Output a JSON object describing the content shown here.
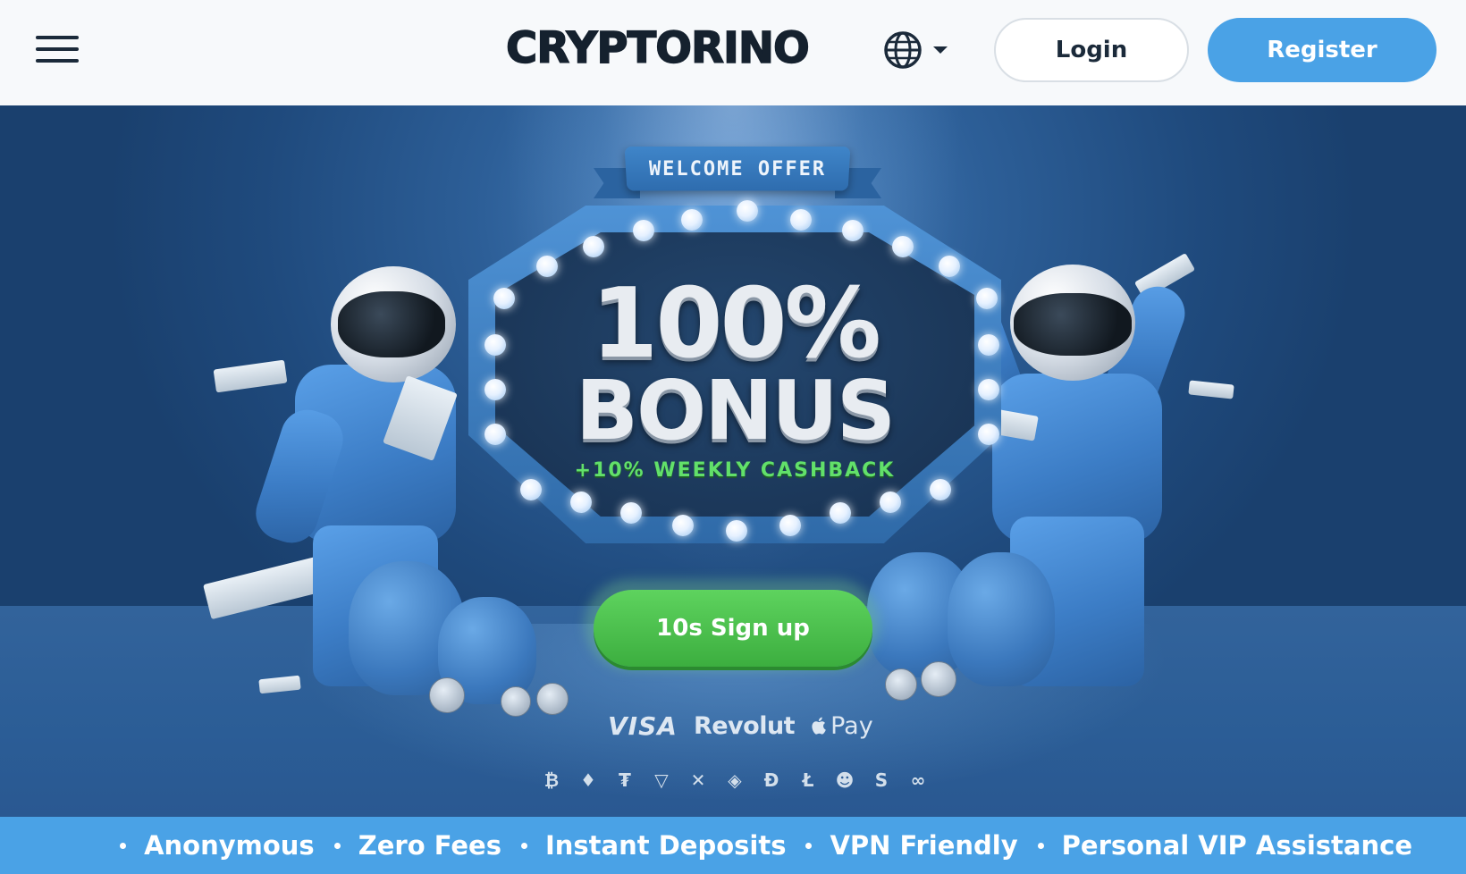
{
  "header": {
    "menu_icon": "hamburger-menu-icon",
    "logo": "CRYPTORINO",
    "language_icon": "globe-icon",
    "login_label": "Login",
    "register_label": "Register"
  },
  "hero": {
    "banner": "WELCOME OFFER",
    "headline_percent": "100%",
    "headline_word": "BONUS",
    "cashback": "+10% WEEKLY CASHBACK",
    "cta_label": "10s Sign up",
    "payment_methods": {
      "visa": "VISA",
      "revolut": "Revolut",
      "apple_pay": "Pay"
    },
    "crypto_icons": [
      "bitcoin-icon",
      "ethereum-icon",
      "tether-icon",
      "tron-icon",
      "xrp-icon",
      "bnb-icon",
      "dogecoin-icon",
      "litecoin-icon",
      "shiba-icon",
      "solana-icon",
      "chainlink-icon"
    ],
    "crypto_glyphs": [
      "₿",
      "♦",
      "₮",
      "▽",
      "✕",
      "◈",
      "Ð",
      "Ł",
      "☻",
      "S",
      "∞"
    ]
  },
  "features": [
    "Anonymous",
    "Zero Fees",
    "Instant Deposits",
    "VPN Friendly",
    "Personal VIP Assistance"
  ],
  "colors": {
    "brand_blue": "#4aa2e6",
    "cta_green": "#4cc24f",
    "cashback_green": "#62e06a",
    "logo_dark": "#15212e"
  }
}
